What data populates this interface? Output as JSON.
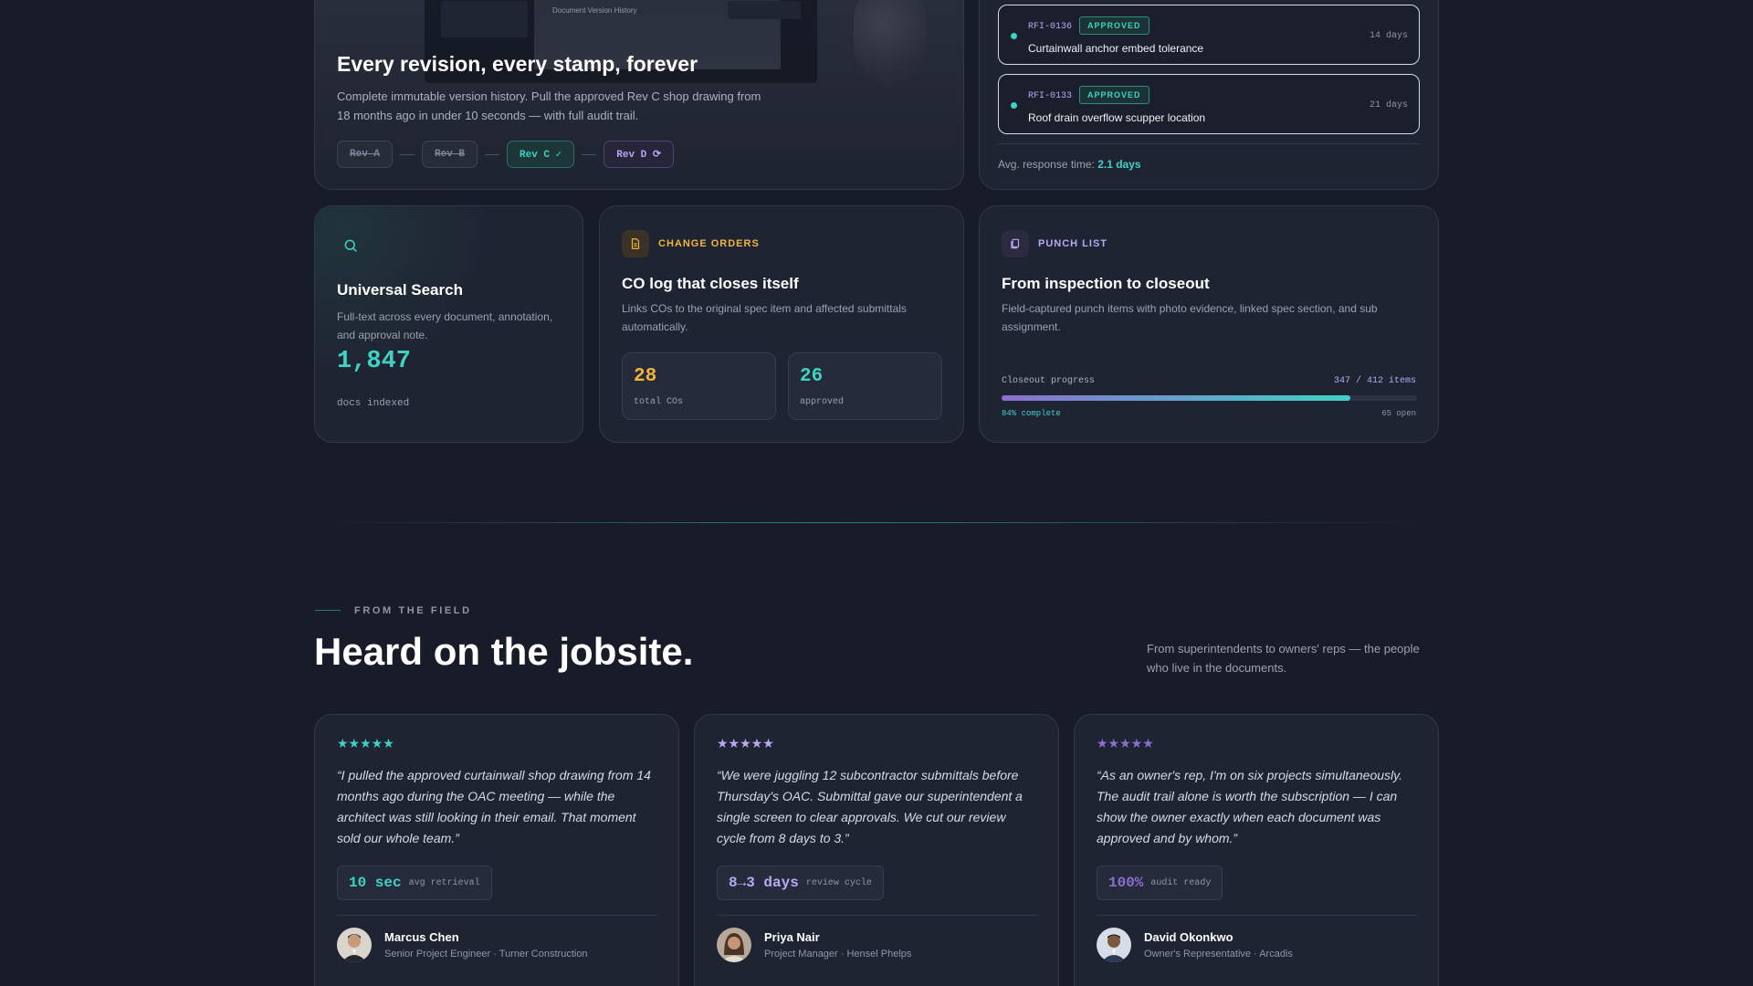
{
  "hero": {
    "screen_title": "Document Version History",
    "title": "Every revision, every stamp, forever",
    "desc": "Complete immutable version history. Pull the approved Rev C shop drawing from 18 months ago in under 10 seconds — with full audit trail.",
    "revisions": [
      "Rev A",
      "Rev B",
      "Rev C ✓",
      "Rev D ⟳"
    ]
  },
  "rfi": {
    "items": [
      {
        "id": "RFI-0136",
        "status": "APPROVED",
        "text": "Curtainwall anchor embed tolerance",
        "days": "14 days"
      },
      {
        "id": "RFI-0133",
        "status": "APPROVED",
        "text": "Roof drain overflow scupper location",
        "days": "21 days"
      }
    ],
    "avg_label": "Avg. response time:",
    "avg_value": "2.1 days"
  },
  "search": {
    "title": "Universal Search",
    "desc": "Full-text across every document, annotation, and approval note.",
    "count": "1,847",
    "count_label": "docs indexed"
  },
  "change_orders": {
    "tag": "CHANGE ORDERS",
    "title": "CO log that closes itself",
    "desc": "Links COs to the original spec item and affected submittals automatically.",
    "stats": [
      {
        "value": "28",
        "label": "total COs"
      },
      {
        "value": "26",
        "label": "approved"
      }
    ]
  },
  "punch_list": {
    "tag": "PUNCH LIST",
    "title": "From inspection to closeout",
    "desc": "Field-captured punch items with photo evidence, linked spec section, and sub assignment.",
    "progress_label": "Closeout progress",
    "count": "347 / 412 items",
    "progress": 0.84,
    "pct_label": "84% complete",
    "open_label": "65 open"
  },
  "testimonials": {
    "eyebrow": "FROM THE FIELD",
    "title": "Heard on the jobsite.",
    "aside": "From superintendents to owners' reps — the people who live in the documents.",
    "items": [
      {
        "stars": "★★★★★",
        "quote": "“I pulled the approved curtainwall shop drawing from 14 months ago during the OAC meeting — while the architect was still looking in their email. That moment sold our whole team.”",
        "metric_value": "10 sec",
        "metric_label": "avg retrieval",
        "name": "Marcus Chen",
        "role": "Senior Project Engineer · Turner Construction"
      },
      {
        "stars": "★★★★★",
        "quote": "“We were juggling 12 subcontractor submittals before Thursday's OAC. Submittal gave our superintendent a single screen to clear approvals. We cut our review cycle from 8 days to 3.”",
        "metric_value": "8→3 days",
        "metric_label": "review cycle",
        "name": "Priya Nair",
        "role": "Project Manager · Hensel Phelps"
      },
      {
        "stars": "★★★★★",
        "quote": "“As an owner's rep, I'm on six projects simultaneously. The audit trail alone is worth the subscription — I can show the owner exactly when each document was approved and by whom.”",
        "metric_value": "100%",
        "metric_label": "audit ready",
        "name": "David Okonkwo",
        "role": "Owner's Representative · Arcadis"
      }
    ]
  },
  "colors": {
    "accent_teal": "#3fd2c4",
    "accent_purple": "#b9a8f4",
    "accent_amber": "#f2b53a",
    "background": "#181c29"
  }
}
